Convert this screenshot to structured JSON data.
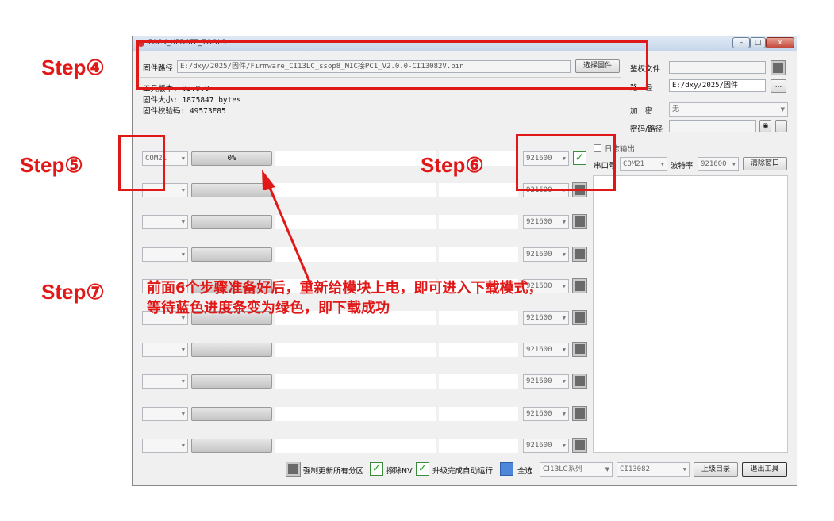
{
  "window": {
    "title": "PACK_UPDATE_TOOLS",
    "minimize": "–",
    "maximize": "□",
    "close": "x"
  },
  "firmware": {
    "path_label": "固件路径",
    "path_value": "E:/dxy/2025/固件/Firmware_CI13LC_ssop8_MIC接PC1_V2.0.0-CI13082V.bin",
    "select_button": "选择固件",
    "tool_version_label": "工具版本: V3.9.9",
    "size_label": "固件大小: 1875847 bytes",
    "checksum_label": "固件校验码: 49573E85"
  },
  "right_panel": {
    "auth_file_label": "鉴权文件",
    "path_label": "路　径",
    "path_value": "E:/dxy/2025/固件",
    "browse_button": "...",
    "encrypt_label": "加　密",
    "encrypt_value": "无",
    "password_label": "密码/路径",
    "log_output_label": "日志输出",
    "serial_label": "串口号",
    "serial_value": "COM21",
    "baud_label": "波特率",
    "baud_value": "921600",
    "clear_button": "清除窗口"
  },
  "ports": [
    {
      "com": "COM21",
      "progress_text": "0%",
      "baud": "921600",
      "enabled": true
    },
    {
      "com": "",
      "progress_text": "",
      "baud": "921600",
      "enabled": false
    },
    {
      "com": "",
      "progress_text": "",
      "baud": "921600",
      "enabled": false
    },
    {
      "com": "",
      "progress_text": "",
      "baud": "921600",
      "enabled": false
    },
    {
      "com": "",
      "progress_text": "",
      "baud": "921600",
      "enabled": false
    },
    {
      "com": "",
      "progress_text": "",
      "baud": "921600",
      "enabled": false
    },
    {
      "com": "",
      "progress_text": "",
      "baud": "921600",
      "enabled": false
    },
    {
      "com": "",
      "progress_text": "",
      "baud": "921600",
      "enabled": false
    },
    {
      "com": "",
      "progress_text": "",
      "baud": "921600",
      "enabled": false
    },
    {
      "com": "",
      "progress_text": "",
      "baud": "921600",
      "enabled": false
    }
  ],
  "bottom": {
    "force_update_label": "强制更新所有分区",
    "erase_nv_label": "擦除NV",
    "auto_run_label": "升级完成自动运行",
    "select_all_label": "全选",
    "series_value": "CI13LC系列",
    "chip_value": "CI13082",
    "parent_dir_button": "上级目录",
    "exit_button": "退出工具"
  },
  "annotations": {
    "step4": "Step④",
    "step5": "Step⑤",
    "step6": "Step⑥",
    "step7": "Step⑦",
    "note_line1": "前面6个步骤准备好后，重新给模块上电，即可进入下载模式，",
    "note_line2": "等待蓝色进度条变为绿色，即下载成功"
  },
  "colors": {
    "annotation": "#e01818",
    "check_green": "#2aa52a",
    "select_all_blue": "#4e86d9"
  }
}
